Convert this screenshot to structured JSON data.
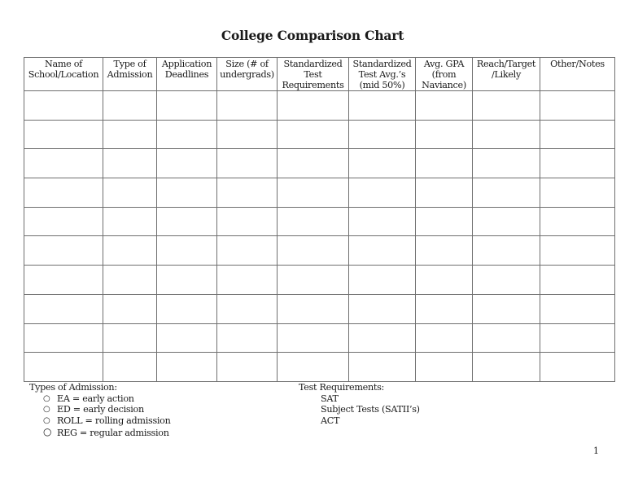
{
  "document": {
    "title": "College Comparison Chart",
    "page_number": "1"
  },
  "table": {
    "columns": [
      {
        "line1": "Name of",
        "line2": "School/Location",
        "line3": ""
      },
      {
        "line1": "Type of",
        "line2": "Admission",
        "line3": ""
      },
      {
        "line1": "Application",
        "line2": "Deadlines",
        "line3": ""
      },
      {
        "line1": "Size (# of",
        "line2": "undergrads)",
        "line3": ""
      },
      {
        "line1": "Standardized",
        "line2": "Test",
        "line3": "Requirements"
      },
      {
        "line1": "Standardized",
        "line2": "Test Avg.’s",
        "line3": "(mid 50%)"
      },
      {
        "line1": "Avg. GPA",
        "line2": "(from",
        "line3": "Naviance)"
      },
      {
        "line1": "Reach/Target",
        "line2": "/Likely",
        "line3": ""
      },
      {
        "line1": "Other/Notes",
        "line2": "",
        "line3": ""
      }
    ],
    "rows": [
      [
        "",
        "",
        "",
        "",
        "",
        "",
        "",
        "",
        ""
      ],
      [
        "",
        "",
        "",
        "",
        "",
        "",
        "",
        "",
        ""
      ],
      [
        "",
        "",
        "",
        "",
        "",
        "",
        "",
        "",
        ""
      ],
      [
        "",
        "",
        "",
        "",
        "",
        "",
        "",
        "",
        ""
      ],
      [
        "",
        "",
        "",
        "",
        "",
        "",
        "",
        "",
        ""
      ],
      [
        "",
        "",
        "",
        "",
        "",
        "",
        "",
        "",
        ""
      ],
      [
        "",
        "",
        "",
        "",
        "",
        "",
        "",
        "",
        ""
      ],
      [
        "",
        "",
        "",
        "",
        "",
        "",
        "",
        "",
        ""
      ],
      [
        "",
        "",
        "",
        "",
        "",
        "",
        "",
        "",
        ""
      ],
      [
        "",
        "",
        "",
        "",
        "",
        "",
        "",
        "",
        ""
      ]
    ]
  },
  "legend_admission": {
    "heading": "Types of Admission:",
    "bullet_icon": "hollow-circle",
    "items": [
      "EA = early action",
      "ED = early decision",
      "ROLL = rolling admission",
      "REG = regular admission"
    ]
  },
  "legend_tests": {
    "heading": "Test Requirements:",
    "items": [
      "SAT",
      "Subject Tests (SATII’s)",
      "ACT"
    ]
  }
}
